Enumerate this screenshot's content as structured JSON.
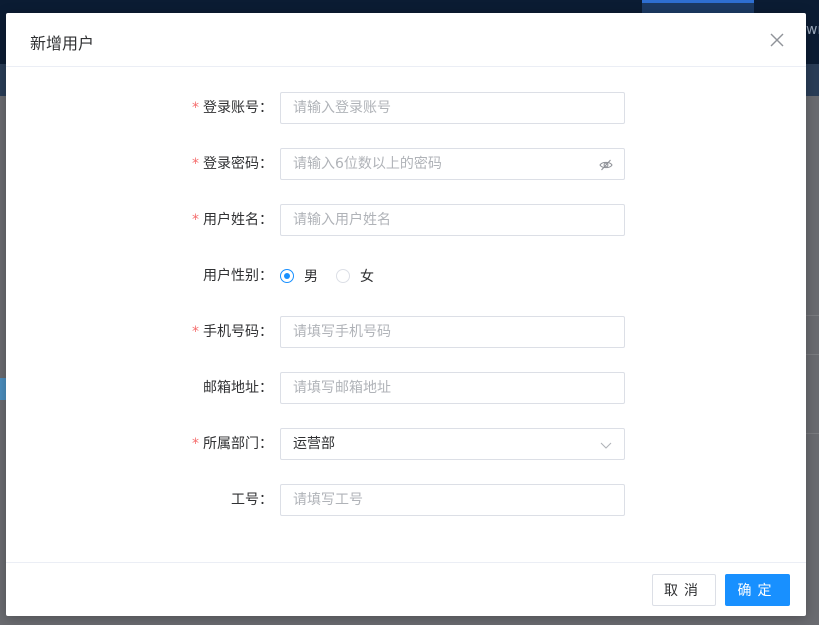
{
  "background": {
    "topbar_peek_text": "wr"
  },
  "dialog": {
    "title": "新增用户",
    "close_icon": "close-icon",
    "fields": {
      "account": {
        "label": "登录账号",
        "required": "*",
        "placeholder": "请输入登录账号",
        "value": ""
      },
      "password": {
        "label": "登录密码",
        "required": "*",
        "placeholder": "请输入6位数以上的密码",
        "value": "",
        "suffix_icon": "eye-off-icon"
      },
      "name": {
        "label": "用户姓名",
        "required": "*",
        "placeholder": "请输入用户姓名",
        "value": ""
      },
      "gender": {
        "label": "用户性别",
        "options": [
          "男",
          "女"
        ],
        "selected": "男"
      },
      "phone": {
        "label": "手机号码",
        "required": "*",
        "placeholder": "请填写手机号码",
        "value": ""
      },
      "email": {
        "label": "邮箱地址",
        "placeholder": "请填写邮箱地址",
        "value": ""
      },
      "department": {
        "label": "所属部门",
        "required": "*",
        "value": "运营部",
        "suffix_icon": "chevron-down-icon"
      },
      "employee_id": {
        "label": "工号",
        "placeholder": "请填写工号",
        "value": ""
      }
    },
    "label_colon": "：",
    "footer": {
      "cancel_label": "取消",
      "ok_label": "确定"
    }
  },
  "colors": {
    "primary": "#1890ff",
    "required": "#f56c6c",
    "overlay": "#6a6b70"
  }
}
